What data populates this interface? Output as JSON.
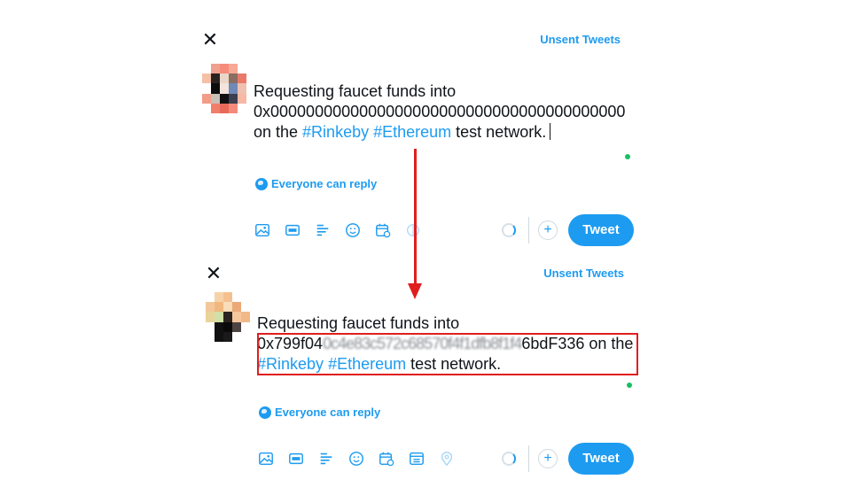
{
  "colors": {
    "accent": "#1d9bf0",
    "annotation": "#e01e1e",
    "status_dot": "#17bf63"
  },
  "composers": [
    {
      "close_icon": "✕",
      "unsent_label": "Unsent Tweets",
      "text": {
        "line1": "Requesting faucet funds into",
        "address": "0x0000000000000000000000000000000000000000",
        "mid": " on the ",
        "tag1": "#Rinkeby",
        "space": " ",
        "tag2": "#Ethereum",
        "tail": " test network."
      },
      "reply_label": "Everyone can reply",
      "tweet_label": "Tweet",
      "plus_label": "+"
    },
    {
      "close_icon": "✕",
      "unsent_label": "Unsent Tweets",
      "text": {
        "line1": "Requesting faucet funds into",
        "address_start": "0x799f04",
        "address_redacted": "0c4e83c572c68570f4f1dfb8f1f4",
        "address_end": "6bdF336",
        "mid": " on the ",
        "tag1": "#Rinkeby",
        "space": " ",
        "tag2": "#Ethereum",
        "tail": " test network."
      },
      "reply_label": "Everyone can reply",
      "tweet_label": "Tweet",
      "plus_label": "+"
    }
  ],
  "toolbar_icons": [
    "image-icon",
    "gif-icon",
    "poll-icon",
    "emoji-icon",
    "schedule-icon",
    "list-icon",
    "location-icon"
  ]
}
